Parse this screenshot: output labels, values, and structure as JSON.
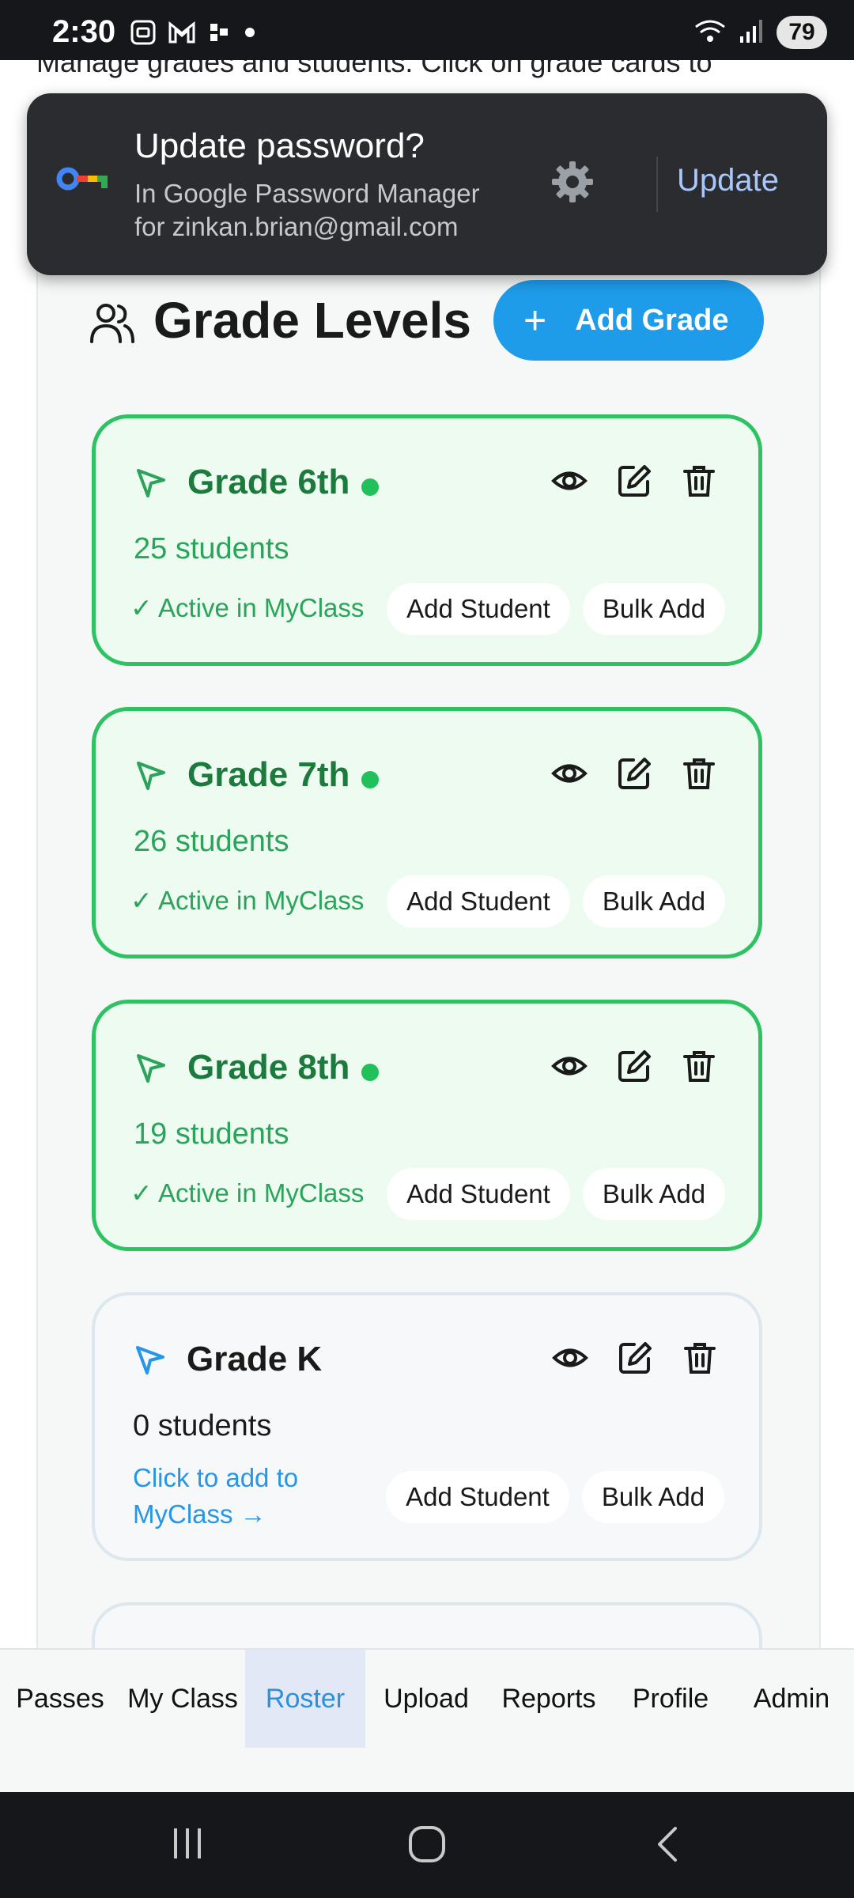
{
  "status_bar": {
    "time": "2:30",
    "battery": "79",
    "icons_left": [
      "screenshot-icon",
      "gmail-icon",
      "slack-icon",
      "dot-icon"
    ],
    "icons_right": [
      "wifi-icon",
      "signal-icon",
      "battery-icon"
    ]
  },
  "intro": {
    "text": "Manage grades and students. Click on grade cards to"
  },
  "toast": {
    "title": "Update password?",
    "subtitle_line1": "In Google Password Manager",
    "subtitle_line2": "for zinkan.brian@gmail.com",
    "update_label": "Update"
  },
  "header": {
    "title": "Grade Levels",
    "add_button_label": "Add Grade"
  },
  "grades": [
    {
      "name": "Grade 6th",
      "count": "25 students",
      "status": "✓ Active in MyClass",
      "active": true
    },
    {
      "name": "Grade 7th",
      "count": "26 students",
      "status": "✓ Active in MyClass",
      "active": true
    },
    {
      "name": "Grade 8th",
      "count": "19 students",
      "status": "✓ Active in MyClass",
      "active": true
    },
    {
      "name": "Grade K",
      "count": "0 students",
      "status_line1": "Click to add to",
      "status_line2": "MyClass →",
      "active": false
    }
  ],
  "card_buttons": {
    "add_student": "Add Student",
    "bulk_add": "Bulk Add"
  },
  "bottom_nav": {
    "items": [
      "Passes",
      "My Class",
      "Roster",
      "Upload",
      "Reports",
      "Profile",
      "Admin"
    ],
    "selected": "Roster"
  },
  "colors": {
    "accent_blue": "#1e9be9",
    "active_green": "#2fc262",
    "active_text_green": "#1b7a3c",
    "toast_bg": "#2b2c30",
    "toast_link": "#a8c7fa"
  }
}
